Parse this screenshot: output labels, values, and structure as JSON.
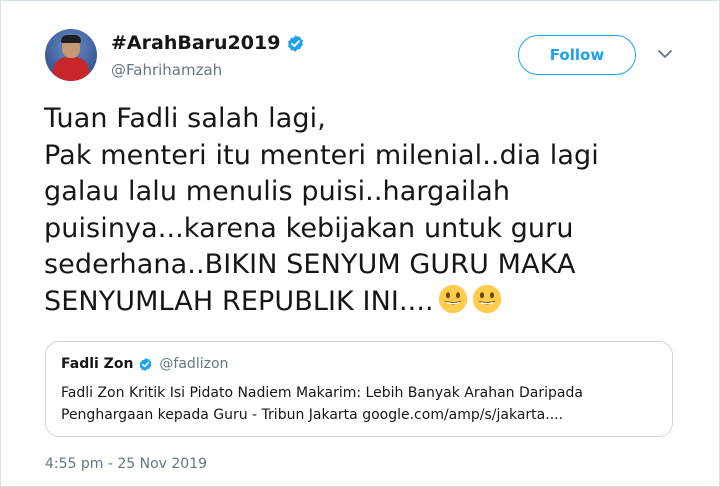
{
  "author": {
    "display_name": "#ArahBaru2019",
    "handle": "@Fahrihamzah",
    "verified": true
  },
  "follow_label": "Follow",
  "tweet_lines": [
    "Tuan Fadli salah lagi,",
    "Pak menteri itu menteri milenial..dia lagi",
    "galau lalu menulis puisi..hargailah",
    "puisinya...karena kebijakan untuk guru",
    "sederhana..BIKIN SENYUM GURU MAKA",
    "SENYUMLAH REPUBLIK INI...."
  ],
  "tweet_emoji": [
    "smiley",
    "smiley"
  ],
  "quoted": {
    "name": "Fadli Zon",
    "handle": "@fadlizon",
    "verified": true,
    "text_lines": [
      "Fadli Zon Kritik Isi Pidato Nadiem Makarim: Lebih Banyak Arahan Daripada",
      "Penghargaan kepada Guru - Tribun Jakarta google.com/amp/s/jakarta...."
    ]
  },
  "timestamp": "4:55 pm - 25 Nov 2019",
  "colors": {
    "accent": "#1da1f2",
    "muted": "#657786",
    "text": "#14171a",
    "border": "#ccd6dd"
  },
  "icons": {
    "verified": "verified-badge-icon",
    "chevron": "chevron-down-icon",
    "emoji": "smiling-face-emoji"
  }
}
